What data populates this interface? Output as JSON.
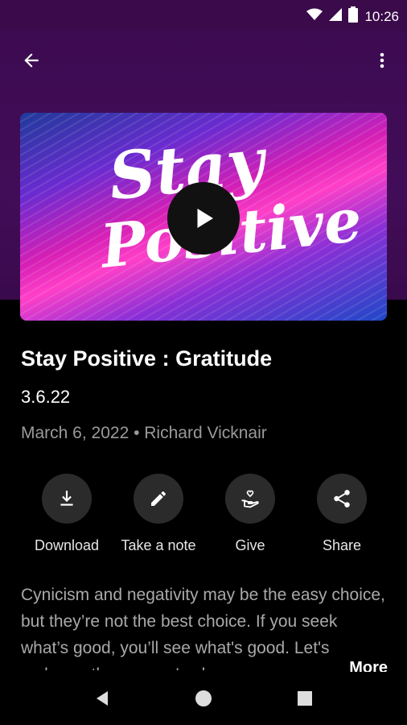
{
  "status_bar": {
    "time": "10:26",
    "icons": [
      "wifi-icon",
      "signal-icon",
      "battery-icon"
    ]
  },
  "app_bar": {
    "back_icon": "arrow-left-icon",
    "more_icon": "more-vert-icon"
  },
  "hero": {
    "art_line1": "Stay",
    "art_line2": "Positive",
    "play_icon": "play-icon"
  },
  "episode": {
    "title": "Stay Positive : Gratitude",
    "subtitle": "3.6.22",
    "meta": "March 6, 2022 • Richard Vicknair"
  },
  "actions": [
    {
      "label": "Download",
      "icon": "download-icon"
    },
    {
      "label": "Take a note",
      "icon": "pencil-icon"
    },
    {
      "label": "Give",
      "icon": "give-hand-heart-icon"
    },
    {
      "label": "Share",
      "icon": "share-icon"
    }
  ],
  "description": {
    "text": "Cynicism and negativity may be the easy choice, but they’re not the best choice. If you seek what’s good, you’ll see what's good. Let's embrace the way we've been crea",
    "more_label": "More"
  },
  "colors": {
    "header_bg": "#3d0b52",
    "background": "#000000",
    "action_circle": "#2b2b2b",
    "meta_text": "#9a9a9a"
  }
}
